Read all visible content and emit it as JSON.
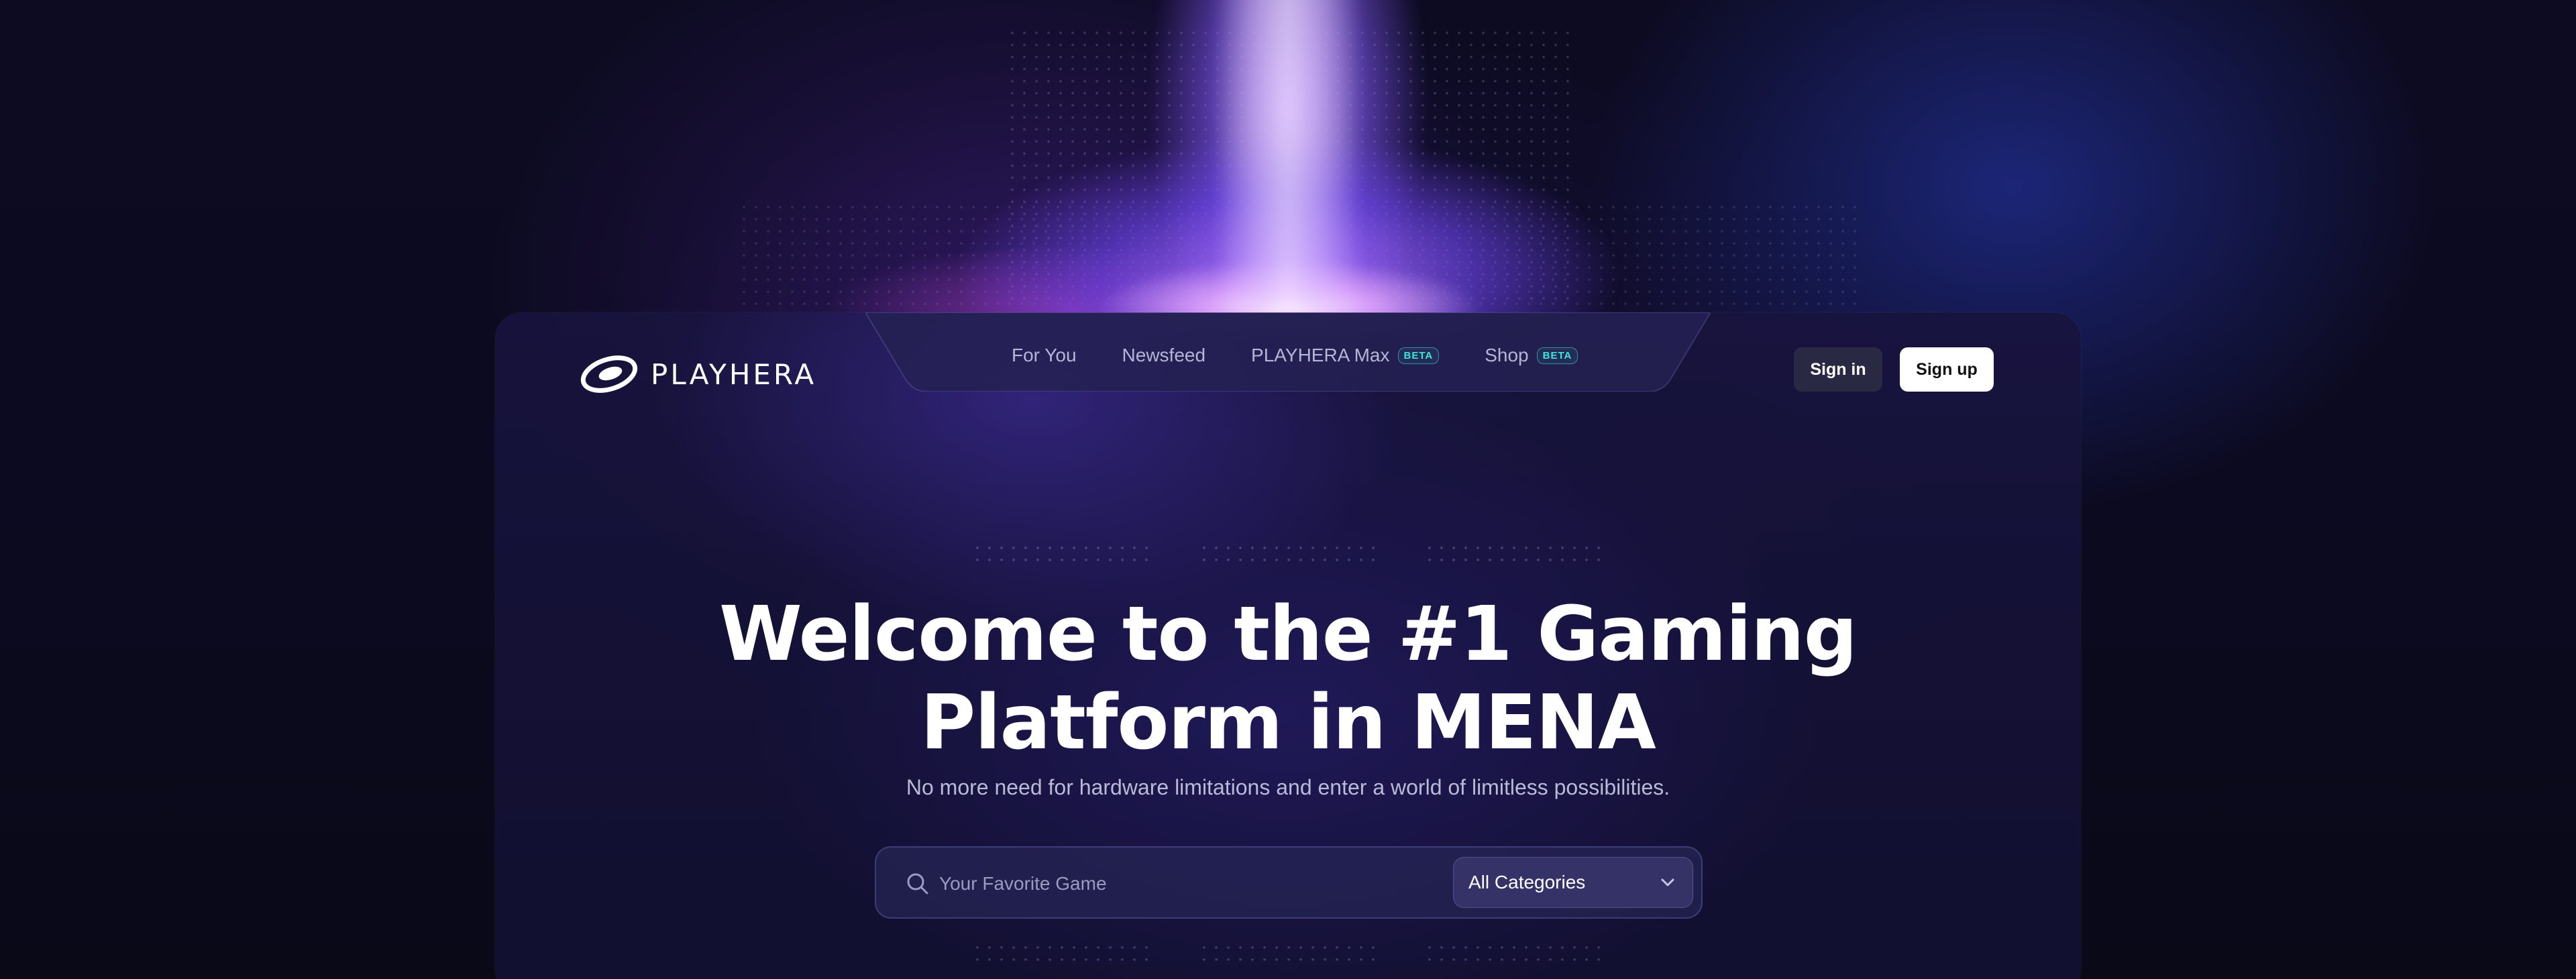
{
  "header": {
    "brand": "PLAYHERA",
    "nav": [
      {
        "label": "For You",
        "badge": ""
      },
      {
        "label": "Newsfeed",
        "badge": ""
      },
      {
        "label": "PLAYHERA Max",
        "badge": "BETA"
      },
      {
        "label": "Shop",
        "badge": "BETA"
      }
    ],
    "signin_label": "Sign in",
    "signup_label": "Sign up"
  },
  "hero": {
    "title_line1": "Welcome to the #1 Gaming",
    "title_line2": "Platform in MENA",
    "subtitle": "No more need for hardware limitations and enter a world of limitless possibilities."
  },
  "search": {
    "placeholder": "Your Favorite Game",
    "category_selected": "All Categories"
  },
  "icons": {
    "logo": "playhera-logo-icon",
    "search": "search-icon",
    "dropdown": "chevron-down-icon"
  },
  "colors": {
    "beta_badge": "#3ee6d8",
    "beam": "#9c6bff",
    "background": "#0a0918"
  }
}
